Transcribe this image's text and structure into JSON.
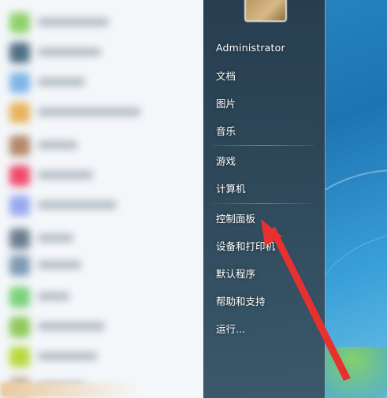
{
  "right_pane": {
    "username": "Administrator",
    "items": [
      {
        "label": "文档"
      },
      {
        "label": "图片"
      },
      {
        "label": "音乐"
      },
      {
        "label": "游戏"
      },
      {
        "label": "计算机"
      },
      {
        "label": "控制面板"
      },
      {
        "label": "设备和打印机"
      },
      {
        "label": "默认程序"
      },
      {
        "label": "帮助和支持"
      },
      {
        "label": "运行..."
      }
    ]
  },
  "colors": {
    "annotation_arrow": "#e8312f",
    "menu_text": "#ffffff",
    "programs_background": "#f4f7fa"
  }
}
